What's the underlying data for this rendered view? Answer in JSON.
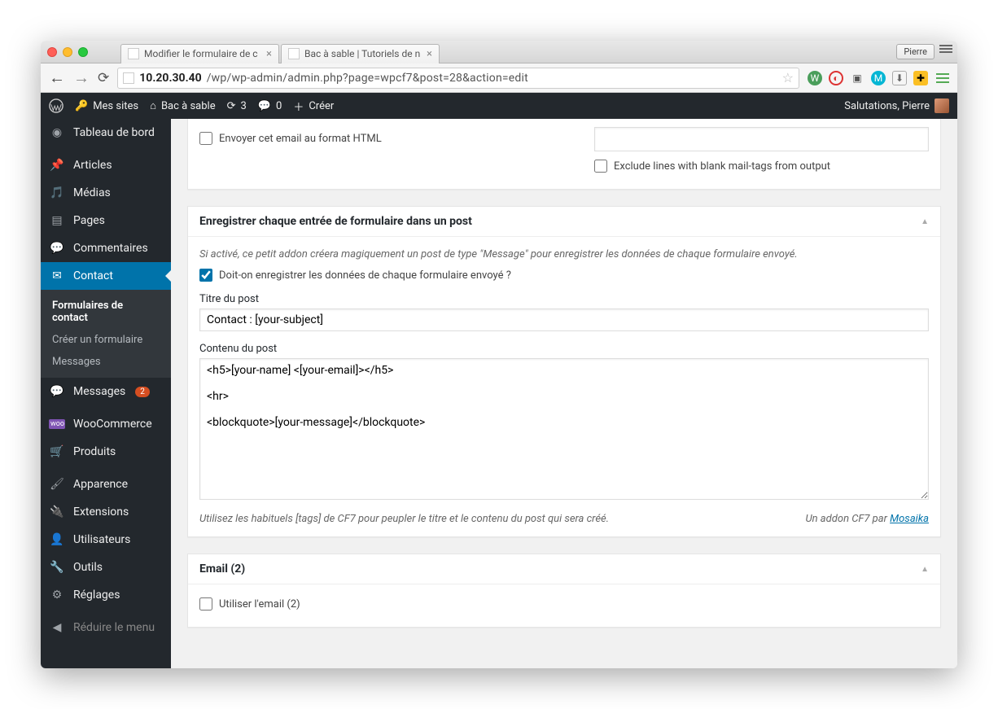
{
  "browser": {
    "tabs": [
      {
        "title": "Modifier le formulaire de c"
      },
      {
        "title": "Bac à sable | Tutoriels de n"
      }
    ],
    "user_button": "Pierre",
    "url_ip": "10.20.30.40",
    "url_rest": "/wp/wp-admin/admin.php?page=wpcf7&post=28&action=edit"
  },
  "wpbar": {
    "my_sites": "Mes sites",
    "site": "Bac à sable",
    "updates": "3",
    "comments": "0",
    "new": "Créer",
    "greeting": "Salutations, Pierre"
  },
  "sidebar": {
    "dashboard": "Tableau de bord",
    "posts": "Articles",
    "media": "Médias",
    "pages": "Pages",
    "comments": "Commentaires",
    "contact": "Contact",
    "contact_sub": {
      "forms": "Formulaires de contact",
      "create": "Créer un formulaire",
      "messages": "Messages"
    },
    "messages": "Messages",
    "messages_badge": "2",
    "woocommerce": "WooCommerce",
    "products": "Produits",
    "appearance": "Apparence",
    "plugins": "Extensions",
    "users": "Utilisateurs",
    "tools": "Outils",
    "settings": "Réglages",
    "collapse": "Réduire le menu"
  },
  "remnant": {
    "html_email": "Envoyer cet email au format HTML",
    "exclude_blank": "Exclude lines with blank mail-tags from output"
  },
  "save_panel": {
    "title": "Enregistrer chaque entrée de formulaire dans un post",
    "description": "Si activé, ce petit addon créera magiquement un post de type \"Message\" pour enregistrer les données de chaque formulaire envoyé.",
    "enable_label": "Doit-on enregistrer les données de chaque formulaire envoyé ?",
    "post_title_label": "Titre du post",
    "post_title_value": "Contact : [your-subject]",
    "post_content_label": "Contenu du post",
    "post_content_value": "<h5>[your-name] <[your-email]></h5>\n\n<hr>\n\n<blockquote>[your-message]</blockquote>",
    "hint": "Utilisez les habituels [tags] de CF7 pour peupler le titre et le contenu du post qui sera créé.",
    "addon_by": "Un addon CF7 par ",
    "addon_link": "Mosaika"
  },
  "email2_panel": {
    "title": "Email (2)",
    "use_label": "Utiliser l'email (2)"
  }
}
